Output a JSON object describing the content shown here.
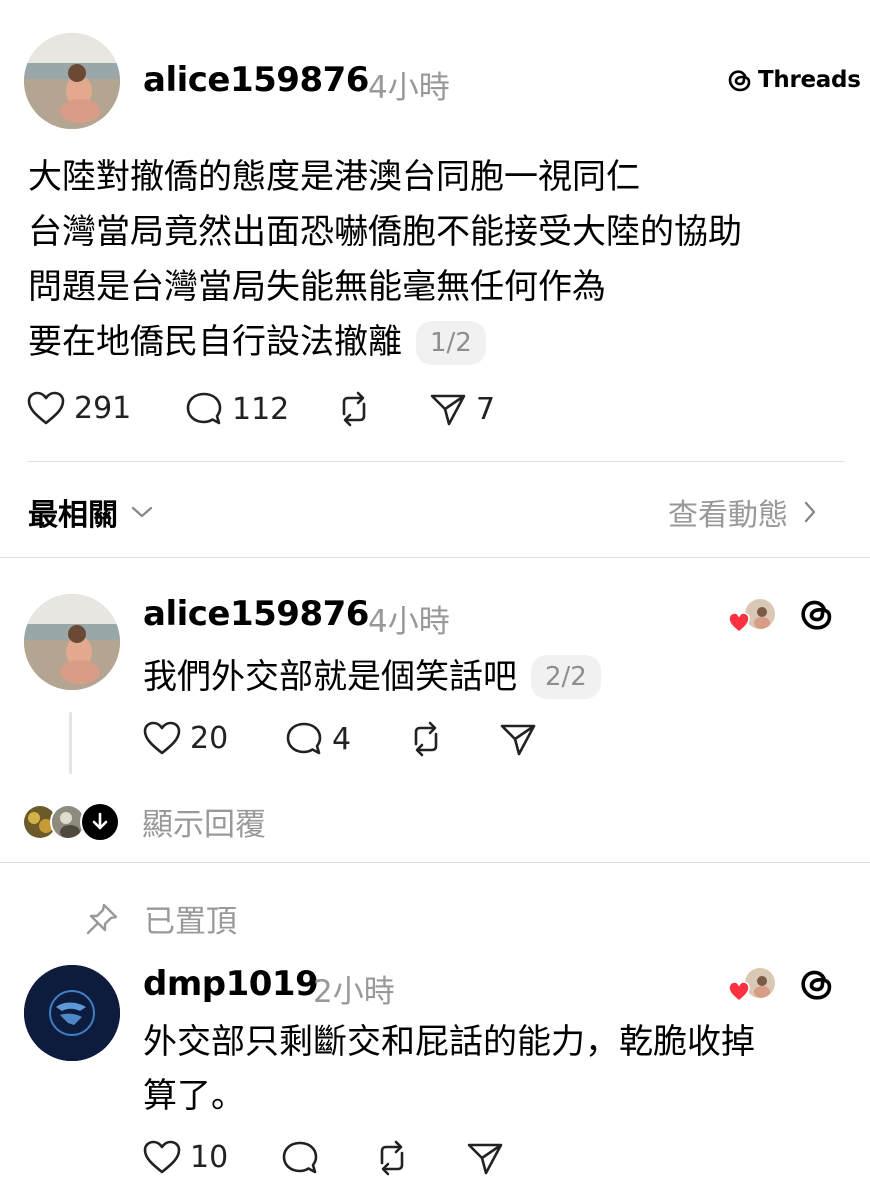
{
  "brand": {
    "threads_label": "Threads",
    "red_heart_color": "#ff3040"
  },
  "post": {
    "username": "alice159876",
    "time": "4小時",
    "lines": [
      "大陸對撤僑的態度是港澳台同胞一視同仁",
      "台灣當局竟然出面恐嚇僑胞不能接受大陸的協助",
      "問題是台灣當局失能無能毫無任何作為",
      "要在地僑民自行設法撤離"
    ],
    "pager": "1/2",
    "likes": "291",
    "comments": "112",
    "shares": "7"
  },
  "sort_bar": {
    "label": "最相關",
    "view_activity": "查看動態"
  },
  "reply1": {
    "username": "alice159876",
    "time": "4小時",
    "text": "我們外交部就是個笑話吧",
    "pager": "2/2",
    "likes": "20",
    "comments": "4"
  },
  "show_replies": {
    "label": "顯示回覆"
  },
  "pinned": {
    "label": "已置頂"
  },
  "reply2": {
    "username": "dmp1019",
    "time": "2小時",
    "line1": "外交部只剩斷交和屁話的能力，乾脆收掉",
    "line2": "算了。",
    "likes": "10"
  }
}
